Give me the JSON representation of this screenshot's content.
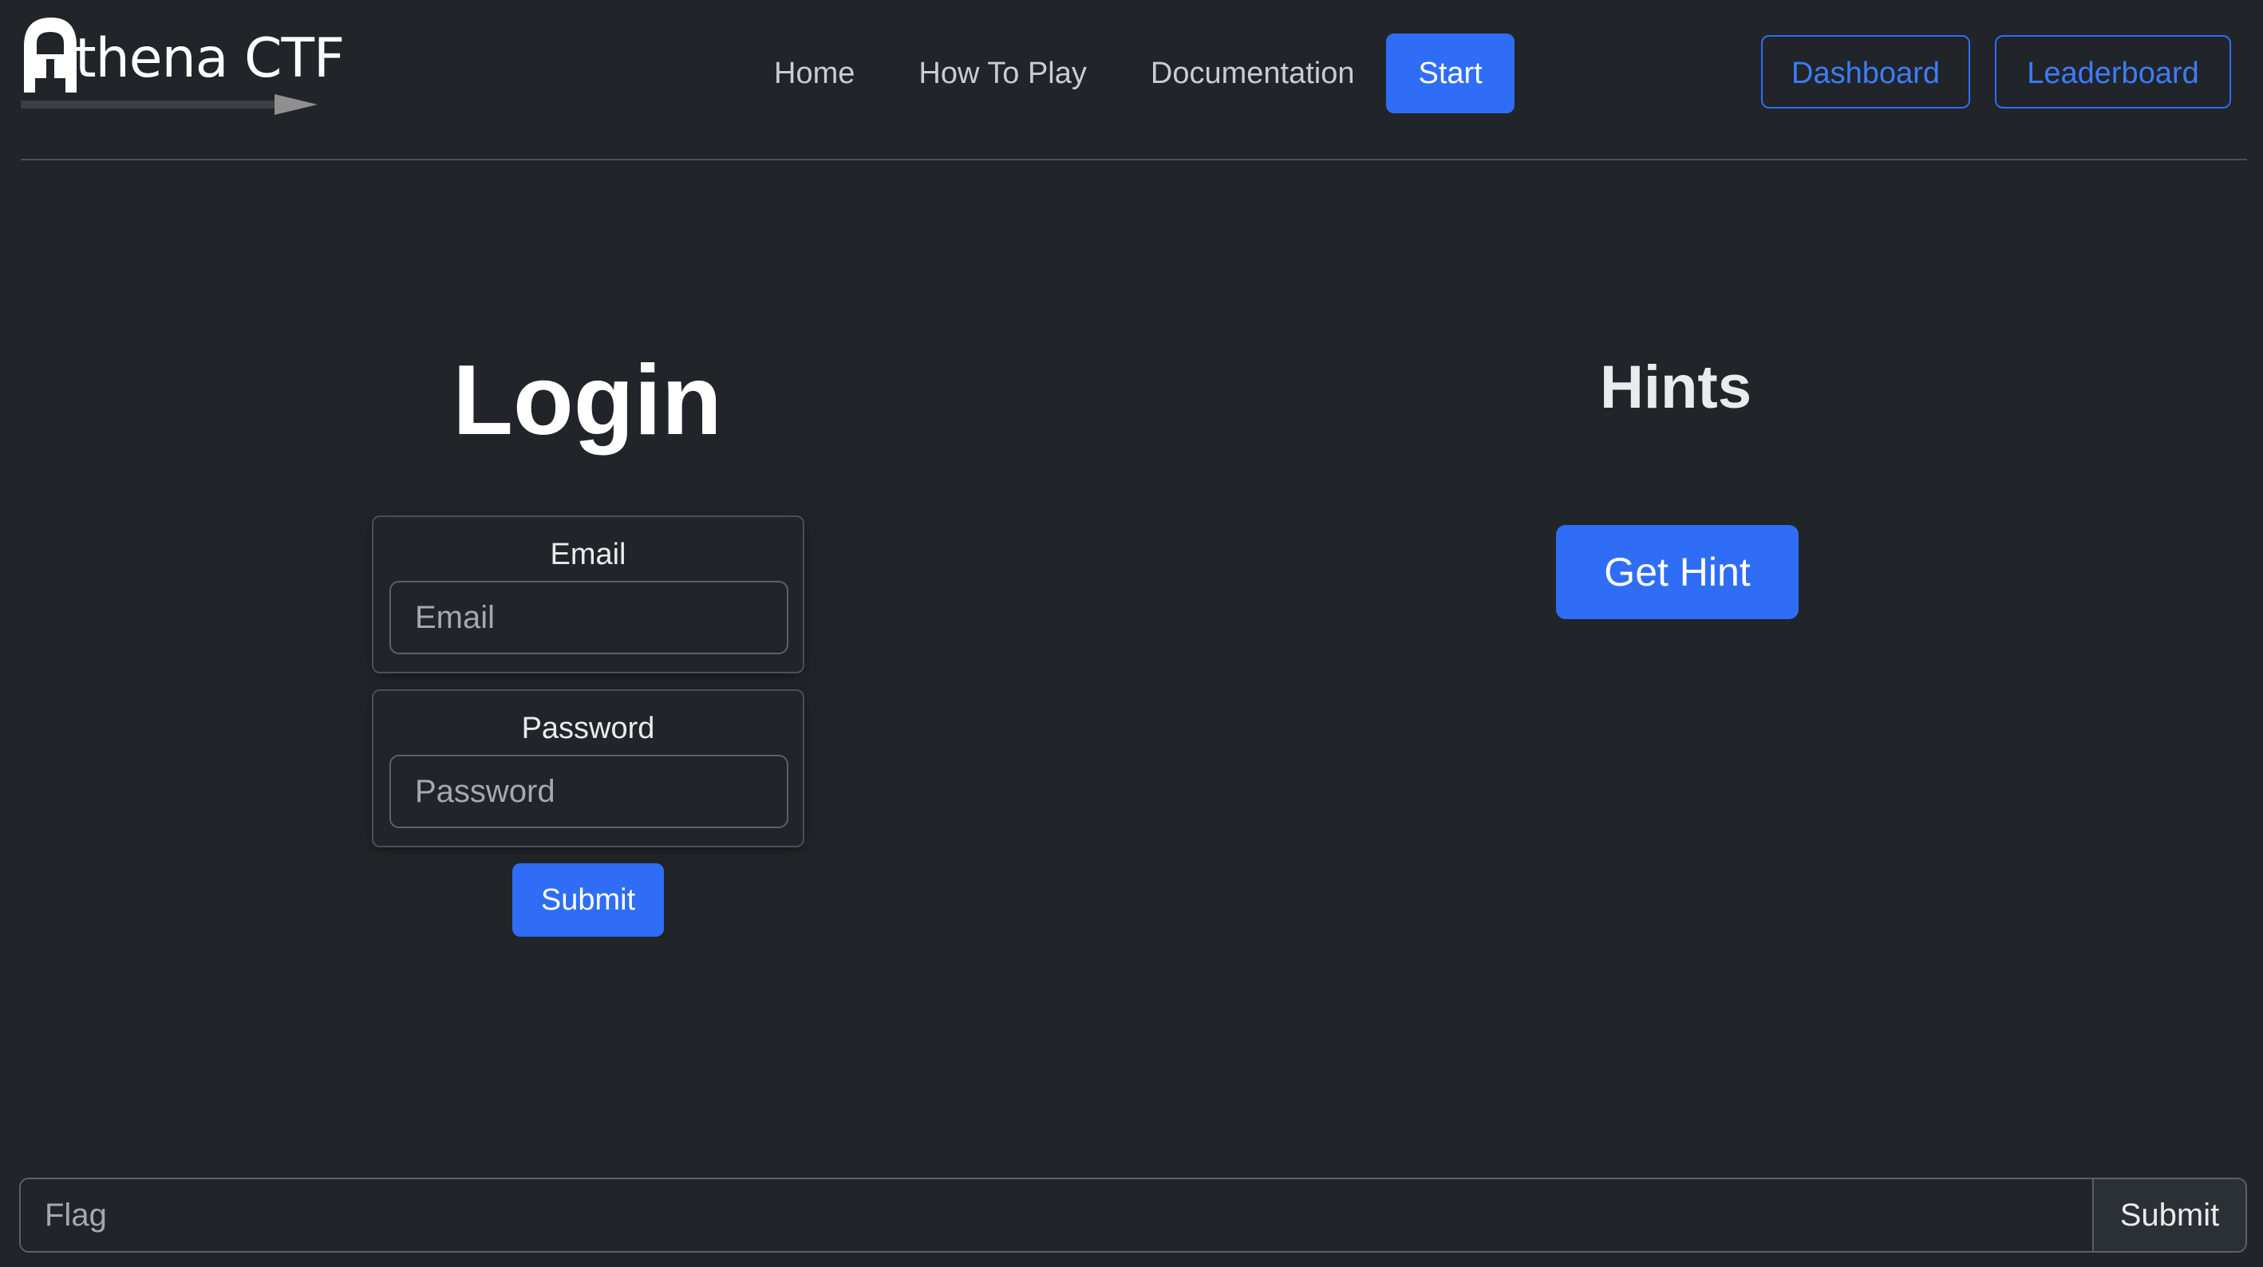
{
  "brand": {
    "logo_icon": "athena-helmet-spear-logo",
    "text": "thena CTF"
  },
  "nav": {
    "links": [
      {
        "label": "Home"
      },
      {
        "label": "How To Play"
      },
      {
        "label": "Documentation"
      }
    ],
    "start_label": "Start",
    "dashboard_label": "Dashboard",
    "leaderboard_label": "Leaderboard"
  },
  "login": {
    "title": "Login",
    "email_label": "Email",
    "email_placeholder": "Email",
    "email_value": "",
    "password_label": "Password",
    "password_placeholder": "Password",
    "password_value": "",
    "submit_label": "Submit"
  },
  "hints": {
    "title": "Hints",
    "button_label": "Get Hint"
  },
  "flag": {
    "placeholder": "Flag",
    "value": "",
    "submit_label": "Submit"
  },
  "colors": {
    "background": "#212529",
    "accent": "#2f6df6",
    "text": "#dee2e6"
  }
}
